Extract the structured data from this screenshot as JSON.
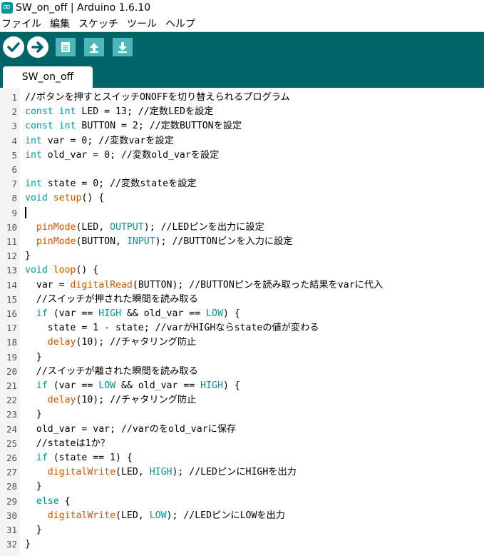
{
  "window": {
    "title": "SW_on_off | Arduino 1.6.10"
  },
  "menu": [
    "ファイル",
    "編集",
    "スケッチ",
    "ツール",
    "ヘルプ"
  ],
  "toolbar": {
    "buttons": [
      "verify-icon",
      "upload-icon",
      "new-icon",
      "open-icon",
      "save-icon"
    ]
  },
  "tab": {
    "label": "SW_on_off"
  },
  "colors": {
    "toolbar": "#006468",
    "keyword": "#00979c",
    "function": "#d35400",
    "button": "#4db7bb"
  },
  "code": [
    {
      "n": "1",
      "parts": [
        {
          "t": "//ボタンを押すとスイッチONOFFを切り替えられるプログラム",
          "c": ""
        }
      ]
    },
    {
      "n": "2",
      "parts": [
        {
          "t": "const",
          "c": "kw"
        },
        {
          "t": " ",
          "c": ""
        },
        {
          "t": "int",
          "c": "kw"
        },
        {
          "t": " LED = 13; //定数LEDを設定",
          "c": ""
        }
      ]
    },
    {
      "n": "3",
      "parts": [
        {
          "t": "const",
          "c": "kw"
        },
        {
          "t": " ",
          "c": ""
        },
        {
          "t": "int",
          "c": "kw"
        },
        {
          "t": " BUTTON = 2; //定数BUTTONを設定",
          "c": ""
        }
      ]
    },
    {
      "n": "4",
      "parts": [
        {
          "t": "int",
          "c": "kw"
        },
        {
          "t": " var = 0; //変数varを設定",
          "c": ""
        }
      ]
    },
    {
      "n": "5",
      "parts": [
        {
          "t": "int",
          "c": "kw"
        },
        {
          "t": " old_var = 0; //変数old_varを設定",
          "c": ""
        }
      ]
    },
    {
      "n": "6",
      "parts": []
    },
    {
      "n": "7",
      "parts": [
        {
          "t": "int",
          "c": "kw"
        },
        {
          "t": " state = 0; //変数stateを設定",
          "c": ""
        }
      ]
    },
    {
      "n": "8",
      "parts": [
        {
          "t": "void",
          "c": "kw"
        },
        {
          "t": " ",
          "c": ""
        },
        {
          "t": "setup",
          "c": "fn"
        },
        {
          "t": "() {",
          "c": ""
        }
      ]
    },
    {
      "n": "9",
      "parts": [],
      "cursor": true
    },
    {
      "n": "10",
      "parts": [
        {
          "t": "  ",
          "c": ""
        },
        {
          "t": "pinMode",
          "c": "fn"
        },
        {
          "t": "(LED, ",
          "c": ""
        },
        {
          "t": "OUTPUT",
          "c": "cst"
        },
        {
          "t": "); //LEDピンを出力に設定",
          "c": ""
        }
      ]
    },
    {
      "n": "11",
      "parts": [
        {
          "t": "  ",
          "c": ""
        },
        {
          "t": "pinMode",
          "c": "fn"
        },
        {
          "t": "(BUTTON, ",
          "c": ""
        },
        {
          "t": "INPUT",
          "c": "cst"
        },
        {
          "t": "); //BUTTONピンを入力に設定",
          "c": ""
        }
      ]
    },
    {
      "n": "12",
      "parts": [
        {
          "t": "}",
          "c": ""
        }
      ]
    },
    {
      "n": "13",
      "parts": [
        {
          "t": "void",
          "c": "kw"
        },
        {
          "t": " ",
          "c": ""
        },
        {
          "t": "loop",
          "c": "fn"
        },
        {
          "t": "() {",
          "c": ""
        }
      ]
    },
    {
      "n": "14",
      "parts": [
        {
          "t": "  var = ",
          "c": ""
        },
        {
          "t": "digitalRead",
          "c": "fn"
        },
        {
          "t": "(BUTTON); //BUTTONピンを読み取った結果をvarに代入",
          "c": ""
        }
      ]
    },
    {
      "n": "15",
      "parts": [
        {
          "t": "  //スイッチが押された瞬間を読み取る",
          "c": ""
        }
      ]
    },
    {
      "n": "16",
      "parts": [
        {
          "t": "  ",
          "c": ""
        },
        {
          "t": "if",
          "c": "kw"
        },
        {
          "t": " (var == ",
          "c": ""
        },
        {
          "t": "HIGH",
          "c": "cst"
        },
        {
          "t": " && old_var == ",
          "c": ""
        },
        {
          "t": "LOW",
          "c": "cst"
        },
        {
          "t": ") {",
          "c": ""
        }
      ]
    },
    {
      "n": "17",
      "parts": [
        {
          "t": "    state = 1 - state; //varがHIGHならstateの値が変わる",
          "c": ""
        }
      ]
    },
    {
      "n": "18",
      "parts": [
        {
          "t": "    ",
          "c": ""
        },
        {
          "t": "delay",
          "c": "fn"
        },
        {
          "t": "(10); //チャタリング防止",
          "c": ""
        }
      ]
    },
    {
      "n": "19",
      "parts": [
        {
          "t": "  }",
          "c": ""
        }
      ]
    },
    {
      "n": "20",
      "parts": [
        {
          "t": "  //スイッチが離された瞬間を読み取る",
          "c": ""
        }
      ]
    },
    {
      "n": "21",
      "parts": [
        {
          "t": "  ",
          "c": ""
        },
        {
          "t": "if",
          "c": "kw"
        },
        {
          "t": " (var == ",
          "c": ""
        },
        {
          "t": "LOW",
          "c": "cst"
        },
        {
          "t": " && old_var == ",
          "c": ""
        },
        {
          "t": "HIGH",
          "c": "cst"
        },
        {
          "t": ") {",
          "c": ""
        }
      ]
    },
    {
      "n": "22",
      "parts": [
        {
          "t": "    ",
          "c": ""
        },
        {
          "t": "delay",
          "c": "fn"
        },
        {
          "t": "(10); //チャタリング防止",
          "c": ""
        }
      ]
    },
    {
      "n": "23",
      "parts": [
        {
          "t": "  }",
          "c": ""
        }
      ]
    },
    {
      "n": "24",
      "parts": [
        {
          "t": "  old_var = var; //varのをold_varに保存",
          "c": ""
        }
      ]
    },
    {
      "n": "25",
      "parts": [
        {
          "t": "  //stateは1か？",
          "c": ""
        }
      ]
    },
    {
      "n": "26",
      "parts": [
        {
          "t": "  ",
          "c": ""
        },
        {
          "t": "if",
          "c": "kw"
        },
        {
          "t": " (state == 1) {",
          "c": ""
        }
      ]
    },
    {
      "n": "27",
      "parts": [
        {
          "t": "    ",
          "c": ""
        },
        {
          "t": "digitalWrite",
          "c": "fn"
        },
        {
          "t": "(LED, ",
          "c": ""
        },
        {
          "t": "HIGH",
          "c": "cst"
        },
        {
          "t": "); //LEDピンにHIGHを出力",
          "c": ""
        }
      ]
    },
    {
      "n": "28",
      "parts": [
        {
          "t": "  }",
          "c": ""
        }
      ]
    },
    {
      "n": "29",
      "parts": [
        {
          "t": "  ",
          "c": ""
        },
        {
          "t": "else",
          "c": "kw"
        },
        {
          "t": " {",
          "c": ""
        }
      ]
    },
    {
      "n": "30",
      "parts": [
        {
          "t": "    ",
          "c": ""
        },
        {
          "t": "digitalWrite",
          "c": "fn"
        },
        {
          "t": "(LED, ",
          "c": ""
        },
        {
          "t": "LOW",
          "c": "cst"
        },
        {
          "t": "); //LEDピンにLOWを出力",
          "c": ""
        }
      ]
    },
    {
      "n": "31",
      "parts": [
        {
          "t": "  }",
          "c": ""
        }
      ]
    },
    {
      "n": "32",
      "parts": [
        {
          "t": "}",
          "c": ""
        }
      ]
    }
  ]
}
